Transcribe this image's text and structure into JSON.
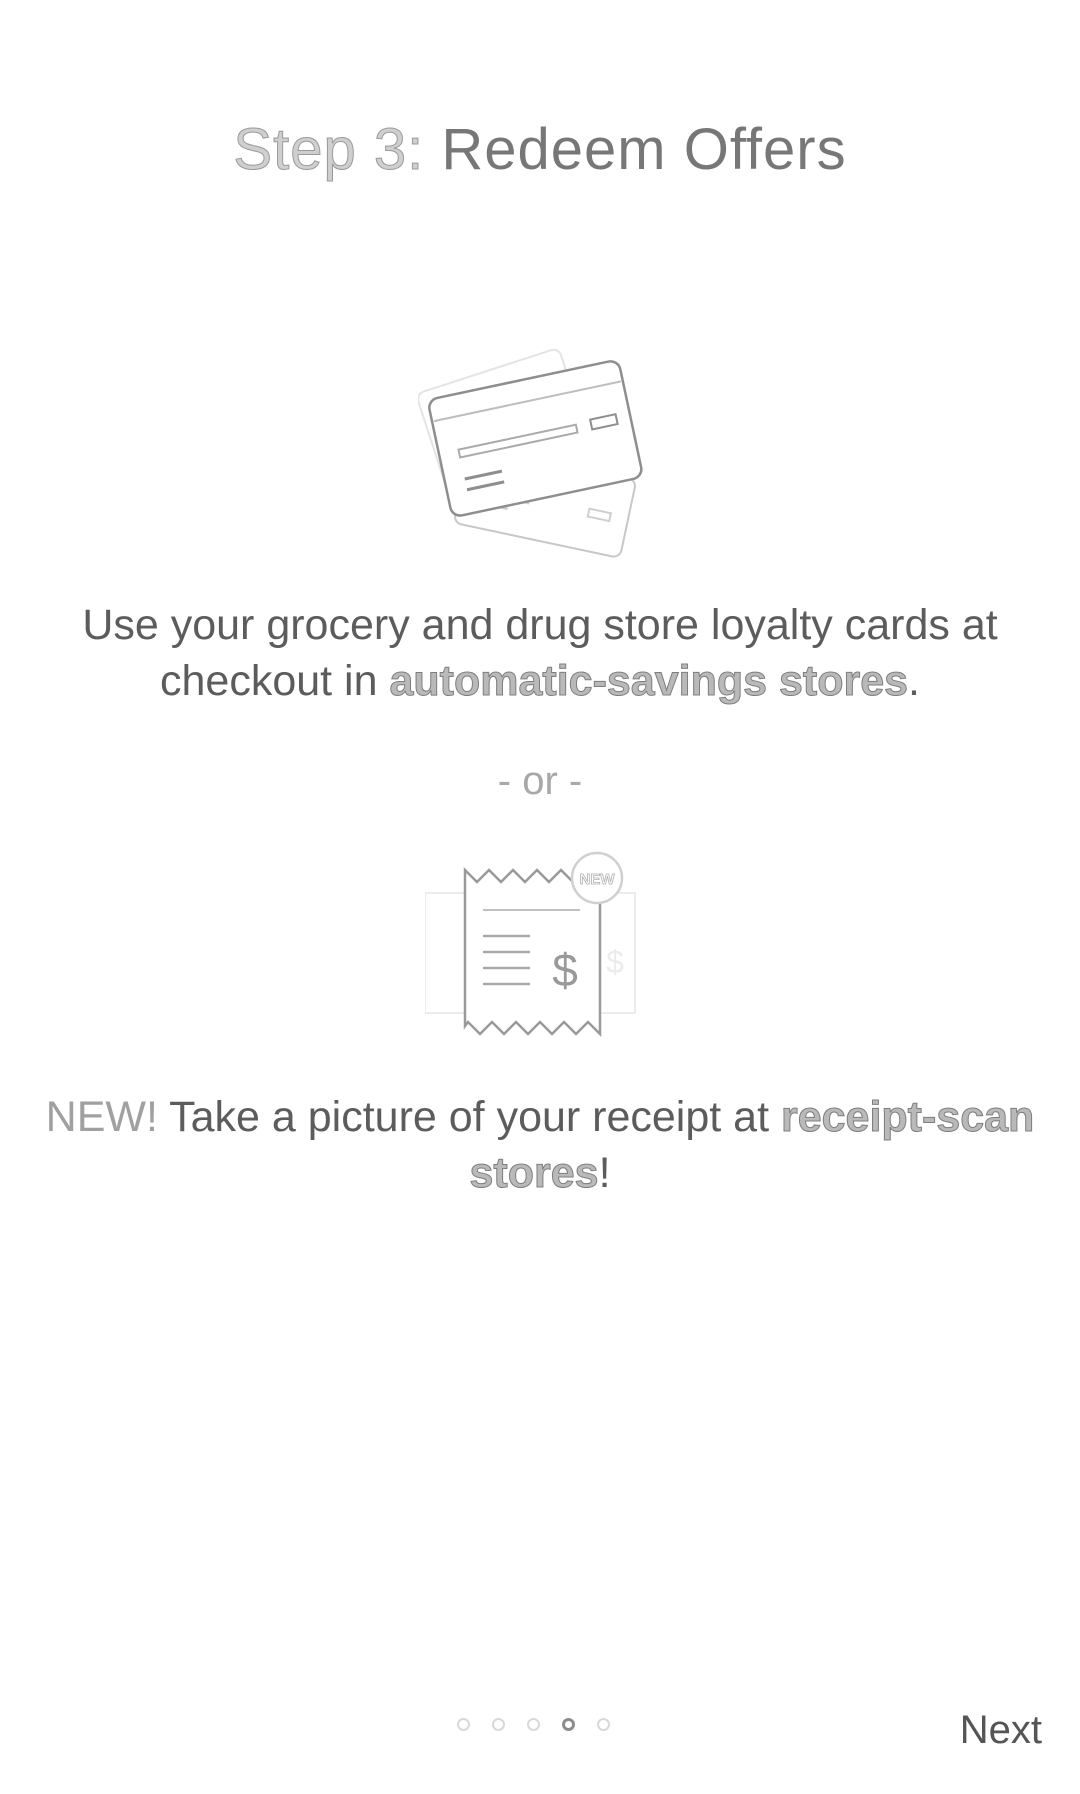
{
  "title": {
    "step": "Step 3:",
    "text": "Redeem Offers"
  },
  "loyalty": {
    "text_before": "Use your grocery and drug store loyalty cards at checkout in ",
    "link": "automatic-savings stores",
    "text_after": "."
  },
  "divider": "- or -",
  "receipt": {
    "new_label": "NEW!",
    "text_before": " Take a picture of your receipt at ",
    "link": "receipt-scan stores",
    "text_after": "!",
    "badge": "NEW"
  },
  "pager": {
    "total": 5,
    "active_index": 3
  },
  "next_label": "Next"
}
